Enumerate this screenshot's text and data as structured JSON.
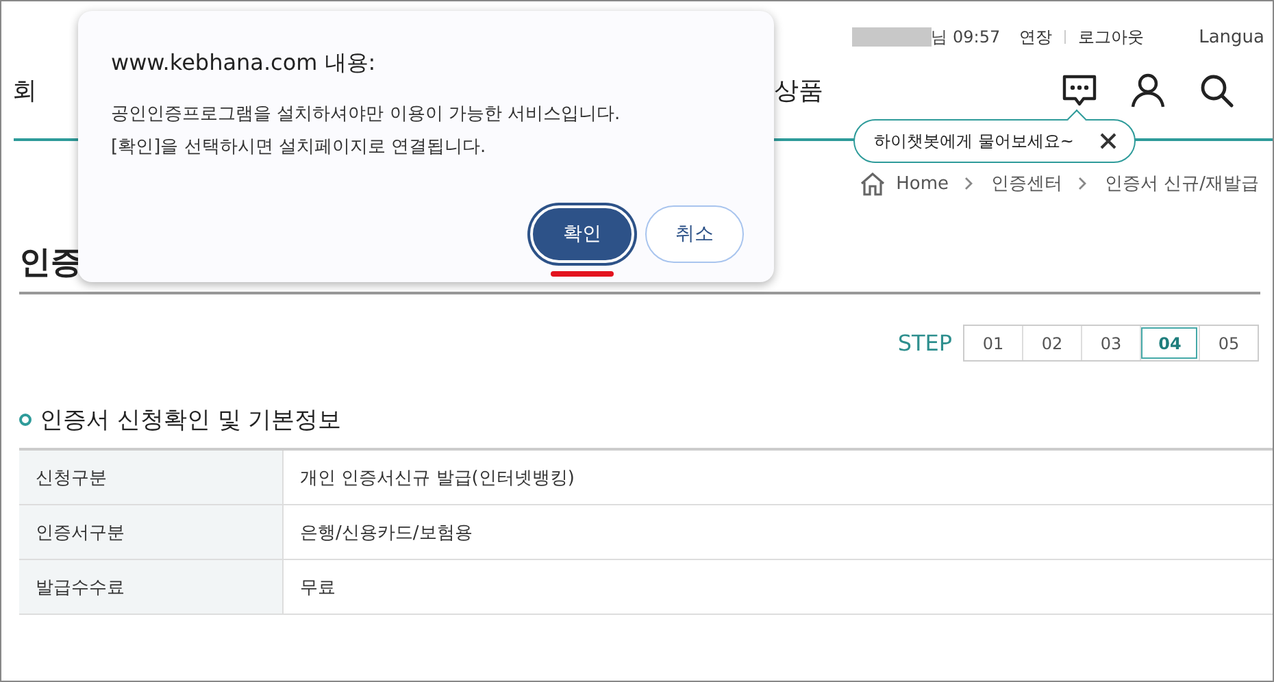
{
  "top_bar": {
    "user_suffix": "님 09:57",
    "links": [
      "연장",
      "로그아웃"
    ],
    "language": "Langua"
  },
  "nav": {
    "left_item": "회",
    "right_item": "상품"
  },
  "chatbot_tip": {
    "text": "하이챗봇에게 물어보세요~"
  },
  "breadcrumb": [
    "Home",
    "인증센터",
    "인증서 신규/재발급"
  ],
  "page_title": "인증",
  "steps": {
    "label": "STEP",
    "items": [
      {
        "label": "01",
        "selected": false
      },
      {
        "label": "02",
        "selected": false
      },
      {
        "label": "03",
        "selected": false
      },
      {
        "label": "04",
        "selected": true
      },
      {
        "label": "05",
        "selected": false
      }
    ]
  },
  "section": {
    "title": "인증서 신청확인 및 기본정보"
  },
  "table": {
    "rows": [
      {
        "label": "신청구분",
        "value": "개인 인증서신규 발급(인터넷뱅킹)"
      },
      {
        "label": "인증서구분",
        "value": "은행/신용카드/보험용"
      },
      {
        "label": "발급수수료",
        "value": "무료"
      }
    ]
  },
  "dialog": {
    "title": "www.kebhana.com 내용:",
    "message": [
      "공인인증프로그램을 설치하셔야만 이용이 가능한 서비스입니다.",
      "[확인]을 선택하시면 설치페이지로 연결됩니다."
    ],
    "buttons": [
      {
        "label": "확인",
        "kind": "primary"
      },
      {
        "label": "취소",
        "kind": "secondary"
      }
    ]
  }
}
